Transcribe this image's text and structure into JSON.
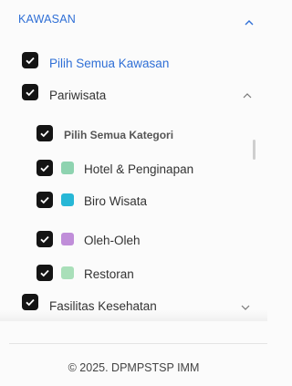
{
  "section": {
    "title": "KAWASAN"
  },
  "select_all_area": {
    "label": "Pilih Semua Kawasan"
  },
  "groups": [
    {
      "label": "Pariwisata",
      "select_all_category": "Pilih Semua Kategori",
      "items": [
        {
          "label": "Hotel & Penginapan",
          "color": "#8ed3b0"
        },
        {
          "label": "Biro Wisata",
          "color": "#27b7d6"
        },
        {
          "label": "Oleh-Oleh",
          "color": "#c08ed9"
        },
        {
          "label": "Restoran",
          "color": "#a9dfb9"
        }
      ]
    },
    {
      "label": "Fasilitas Kesehatan"
    }
  ],
  "footer": {
    "copyright": "© 2025. DPMPSTSP IMM"
  },
  "icons": {
    "checkbox": "check-icon",
    "expand": "chevron-up-icon",
    "collapse": "chevron-down-icon"
  },
  "colors": {
    "accent": "#2f6fd6",
    "checkbox": "#141414"
  }
}
